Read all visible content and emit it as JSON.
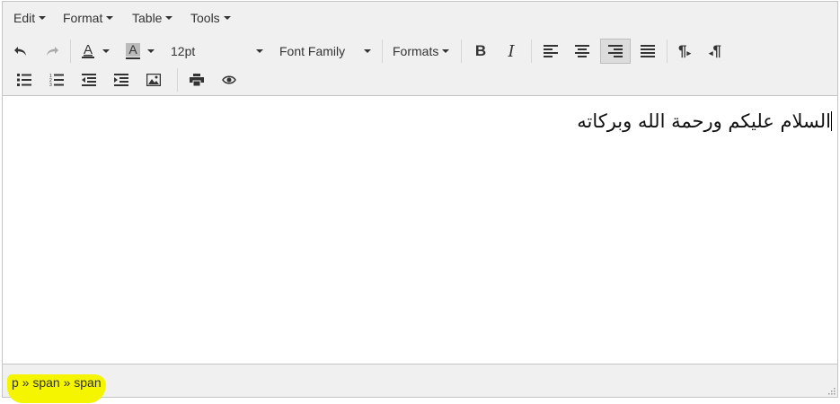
{
  "menubar": {
    "items": [
      {
        "label": "Edit"
      },
      {
        "label": "Format"
      },
      {
        "label": "Table"
      },
      {
        "label": "Tools"
      }
    ]
  },
  "toolbar": {
    "font_size": "12pt",
    "font_family": "Font Family",
    "formats": "Formats",
    "active_button": "align-right",
    "icons": [
      "undo",
      "redo",
      "text-color",
      "background-color",
      "bold",
      "italic",
      "align-left",
      "align-center",
      "align-right",
      "align-justify",
      "ltr",
      "rtl",
      "bullet-list",
      "numbered-list",
      "outdent",
      "indent",
      "image",
      "print",
      "preview"
    ]
  },
  "content": {
    "text": "السلام عليكم ورحمة الله وبركاته",
    "direction": "rtl"
  },
  "statusbar": {
    "path": "p » span » span",
    "highlight_color": "#f5f500"
  }
}
